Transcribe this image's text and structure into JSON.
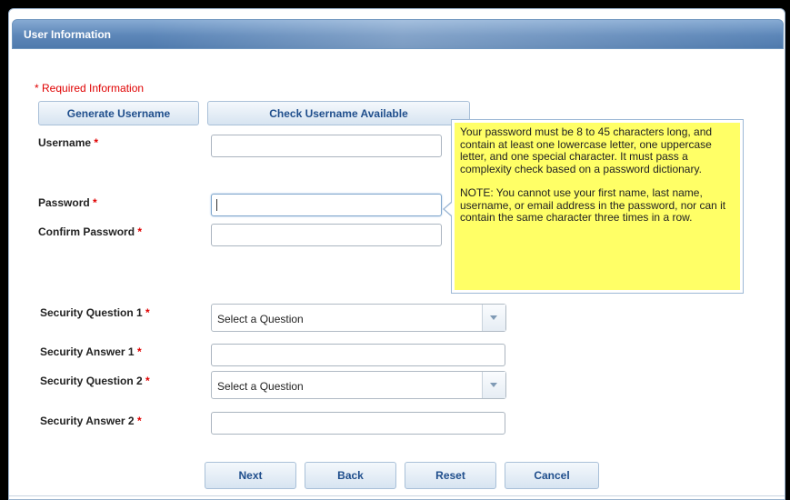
{
  "panel": {
    "title": "User Information"
  },
  "required_note": "* Required Information",
  "actions": {
    "generate_username": "Generate Username",
    "check_username": "Check Username Available"
  },
  "fields": {
    "username_label": "Username",
    "password_label": "Password",
    "confirm_password_label": "Confirm Password",
    "security_question_1_label": "Security Question 1",
    "security_answer_1_label": "Security Answer 1",
    "security_question_2_label": "Security Question 2",
    "security_answer_2_label": "Security Answer 2",
    "required_marker": "*",
    "username_value": "",
    "password_value": "",
    "confirm_password_value": "",
    "security_answer_1_value": "",
    "security_answer_2_value": "",
    "security_question_1_selected": "Select a Question",
    "security_question_2_selected": "Select a Question"
  },
  "tooltip": {
    "paragraph1": "Your password must be 8 to 45 characters long, and contain at least one lowercase letter, one uppercase letter, and one special character. It must pass a complexity check based on a password dictionary.",
    "paragraph2": "NOTE: You cannot use your first name, last name, username, or email address in the password, nor can it contain the same character three times in a row."
  },
  "buttons": {
    "next": "Next",
    "back": "Back",
    "reset": "Reset",
    "cancel": "Cancel"
  },
  "colors": {
    "header_blue": "#5c86b8",
    "required_red": "#e00000",
    "tooltip_yellow": "#ffff66",
    "button_text": "#1f4e8c"
  }
}
